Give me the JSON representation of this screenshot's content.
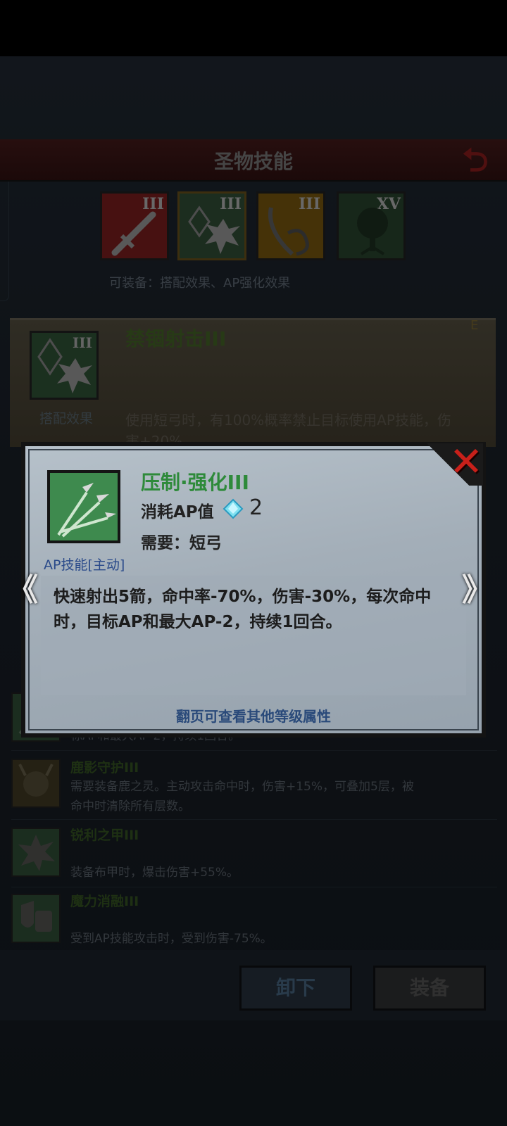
{
  "page": {
    "title": "圣物技能",
    "equip_note": "可装备：搭配效果、AP强化效果"
  },
  "relics": [
    {
      "level": "III",
      "icon": "sword-icon"
    },
    {
      "level": "III",
      "icon": "crystal-burst-icon"
    },
    {
      "level": "III",
      "icon": "flaming-blade-icon"
    },
    {
      "level": "XV",
      "icon": "tree-icon"
    }
  ],
  "bg_card": {
    "level": "III",
    "name": "禁锢射击III",
    "label": "搭配效果",
    "desc": "使用短弓时，有100%概率禁止目标使用AP技能，伤害+20%",
    "corner": "E"
  },
  "list": [
    {
      "name": "",
      "desc": "标AP和最大AP-2，持续1回合。",
      "icon": "arrow-icon"
    },
    {
      "name": "鹿影守护III",
      "desc": "需要装备鹿之灵。主动攻击命中时，伤害+15%，可叠加5层，被命中时清除所有层数。",
      "icon": "stag-icon"
    },
    {
      "name": "锐利之甲III",
      "desc": "装备布甲时，爆击伤害+55%。",
      "icon": "burst-icon"
    },
    {
      "name": "魔力消融III",
      "desc": "受到AP技能攻击时，受到伤害-75%。",
      "icon": "shield-armor-icon"
    }
  ],
  "buttons": {
    "unequip": "卸下",
    "equip": "装备"
  },
  "modal": {
    "skill_name": "压制·强化III",
    "skill_type": "AP技能[主动]",
    "ap_label": "消耗AP值",
    "ap_value": "2",
    "requirement": "需要：短弓",
    "description": "快速射出5箭，命中率-70%，伤害-30%，每次命中时，目标AP和最大AP-2，持续1回合。",
    "page_hint": "翻页可查看其他等级属性",
    "prev_symbol": "《",
    "next_symbol": "》",
    "close_symbol": "✕"
  },
  "colors": {
    "skill_name": "#2e8a3a",
    "close": "#c8201a",
    "modal_bg": "#a9b4be"
  }
}
